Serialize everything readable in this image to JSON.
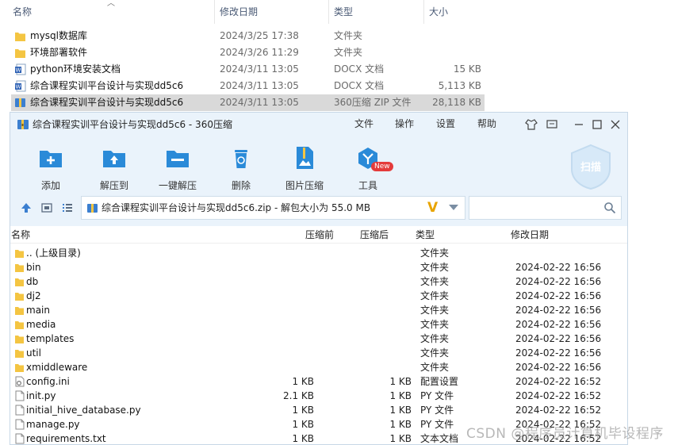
{
  "explorer": {
    "columns": {
      "name": "名称",
      "date": "修改日期",
      "type": "类型",
      "size": "大小"
    },
    "rows": [
      {
        "name": "mysql数据库",
        "date": "2024/3/25 17:38",
        "type": "文件夹",
        "size": "",
        "icon": "folder-icon"
      },
      {
        "name": "环境部署软件",
        "date": "2024/3/26 11:29",
        "type": "文件夹",
        "size": "",
        "icon": "folder-icon"
      },
      {
        "name": "python环境安装文档",
        "date": "2024/3/11 13:05",
        "type": "DOCX 文档",
        "size": "15 KB",
        "icon": "word-doc-icon"
      },
      {
        "name": "综合课程实训平台设计与实现dd5c6",
        "date": "2024/3/11 13:05",
        "type": "DOCX 文档",
        "size": "5,113 KB",
        "icon": "word-doc-icon"
      },
      {
        "name": "综合课程实训平台设计与实现dd5c6",
        "date": "2024/3/11 13:05",
        "type": "360压缩 ZIP 文件",
        "size": "28,118 KB",
        "icon": "zip-archive-icon",
        "selected": true
      }
    ]
  },
  "window": {
    "title": "综合课程实训平台设计与实现dd5c6 - 360压缩",
    "menu": [
      "文件",
      "操作",
      "设置",
      "帮助"
    ],
    "toolbar": {
      "add": "添加",
      "extract_to": "解压到",
      "one_click_extract": "一键解压",
      "delete": "删除",
      "image_compress": "图片压缩",
      "tools": "工具",
      "new_badge": "New",
      "scan": "扫描"
    },
    "address": {
      "path": "综合课程实训平台设计与实现dd5c6.zip - 解包大小为 55.0 MB",
      "search_placeholder": ""
    },
    "list": {
      "columns": {
        "name": "名称",
        "compressed": "压缩前",
        "uncompressed": "压缩后",
        "type": "类型",
        "modified": "修改日期"
      },
      "rows": [
        {
          "name": ".. (上级目录)",
          "cs": "",
          "us": "",
          "type": "文件夹",
          "date": "",
          "kind": "folder"
        },
        {
          "name": "bin",
          "cs": "",
          "us": "",
          "type": "文件夹",
          "date": "2024-02-22 16:56",
          "kind": "folder"
        },
        {
          "name": "db",
          "cs": "",
          "us": "",
          "type": "文件夹",
          "date": "2024-02-22 16:56",
          "kind": "folder"
        },
        {
          "name": "dj2",
          "cs": "",
          "us": "",
          "type": "文件夹",
          "date": "2024-02-22 16:56",
          "kind": "folder"
        },
        {
          "name": "main",
          "cs": "",
          "us": "",
          "type": "文件夹",
          "date": "2024-02-22 16:56",
          "kind": "folder"
        },
        {
          "name": "media",
          "cs": "",
          "us": "",
          "type": "文件夹",
          "date": "2024-02-22 16:56",
          "kind": "folder"
        },
        {
          "name": "templates",
          "cs": "",
          "us": "",
          "type": "文件夹",
          "date": "2024-02-22 16:56",
          "kind": "folder"
        },
        {
          "name": "util",
          "cs": "",
          "us": "",
          "type": "文件夹",
          "date": "2024-02-22 16:56",
          "kind": "folder"
        },
        {
          "name": "xmiddleware",
          "cs": "",
          "us": "",
          "type": "文件夹",
          "date": "2024-02-22 16:56",
          "kind": "folder"
        },
        {
          "name": "config.ini",
          "cs": "1 KB",
          "us": "1 KB",
          "type": "配置设置",
          "date": "2024-02-22 16:52",
          "kind": "config"
        },
        {
          "name": "init.py",
          "cs": "2.1 KB",
          "us": "1 KB",
          "type": "PY 文件",
          "date": "2024-02-22 16:52",
          "kind": "file"
        },
        {
          "name": "initial_hive_database.py",
          "cs": "1 KB",
          "us": "1 KB",
          "type": "PY 文件",
          "date": "2024-02-22 16:52",
          "kind": "file"
        },
        {
          "name": "manage.py",
          "cs": "1 KB",
          "us": "1 KB",
          "type": "PY 文件",
          "date": "2024-02-22 16:52",
          "kind": "file"
        },
        {
          "name": "requirements.txt",
          "cs": "1 KB",
          "us": "1 KB",
          "type": "文本文档",
          "date": "2024-02-22 16:52",
          "kind": "file"
        }
      ]
    }
  },
  "watermark": "CSDN @程序员计算机毕设程序",
  "colors": {
    "window_bg": "#eaf3fb",
    "folder": "#f4c542",
    "accent": "#2a8ad8",
    "badge": "#e43b3b"
  }
}
